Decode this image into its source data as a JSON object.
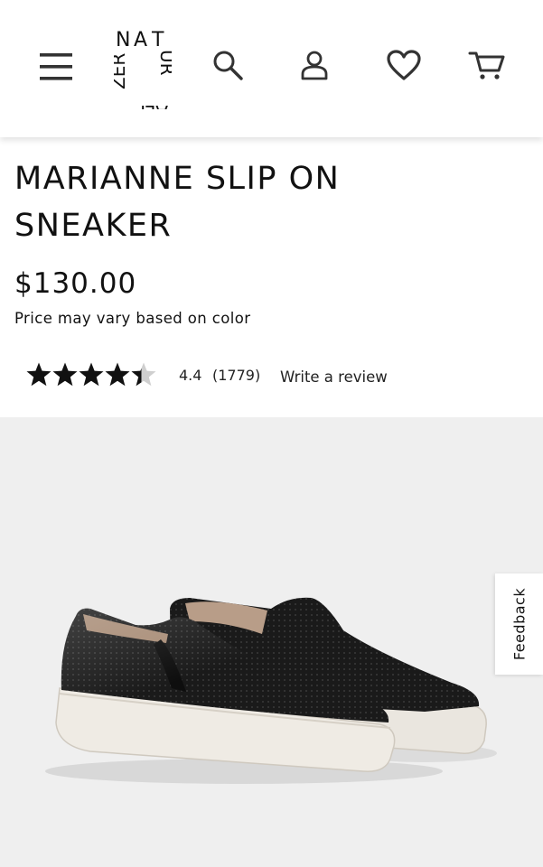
{
  "header": {
    "logo_letters": [
      "N",
      "A",
      "T",
      "U",
      "R",
      "A",
      "L",
      "I",
      "Z",
      "E",
      "R"
    ],
    "icons": [
      "menu-icon",
      "search-icon",
      "account-icon",
      "wishlist-icon",
      "cart-icon"
    ]
  },
  "product": {
    "title": "MARIANNE SLIP ON SNEAKER",
    "price": "$130.00",
    "price_note": "Price may vary based on color",
    "rating_value": "4.4",
    "review_count": "(1779)",
    "write_review": "Write a review",
    "rating": 4.4,
    "rating_max": 5
  },
  "feedback": {
    "label": "Feedback"
  },
  "colors": {
    "header_bg": "#ffffff",
    "image_bg": "#efefef",
    "text": "#111111",
    "star": "#111111",
    "star_empty": "#cfcfcf"
  }
}
